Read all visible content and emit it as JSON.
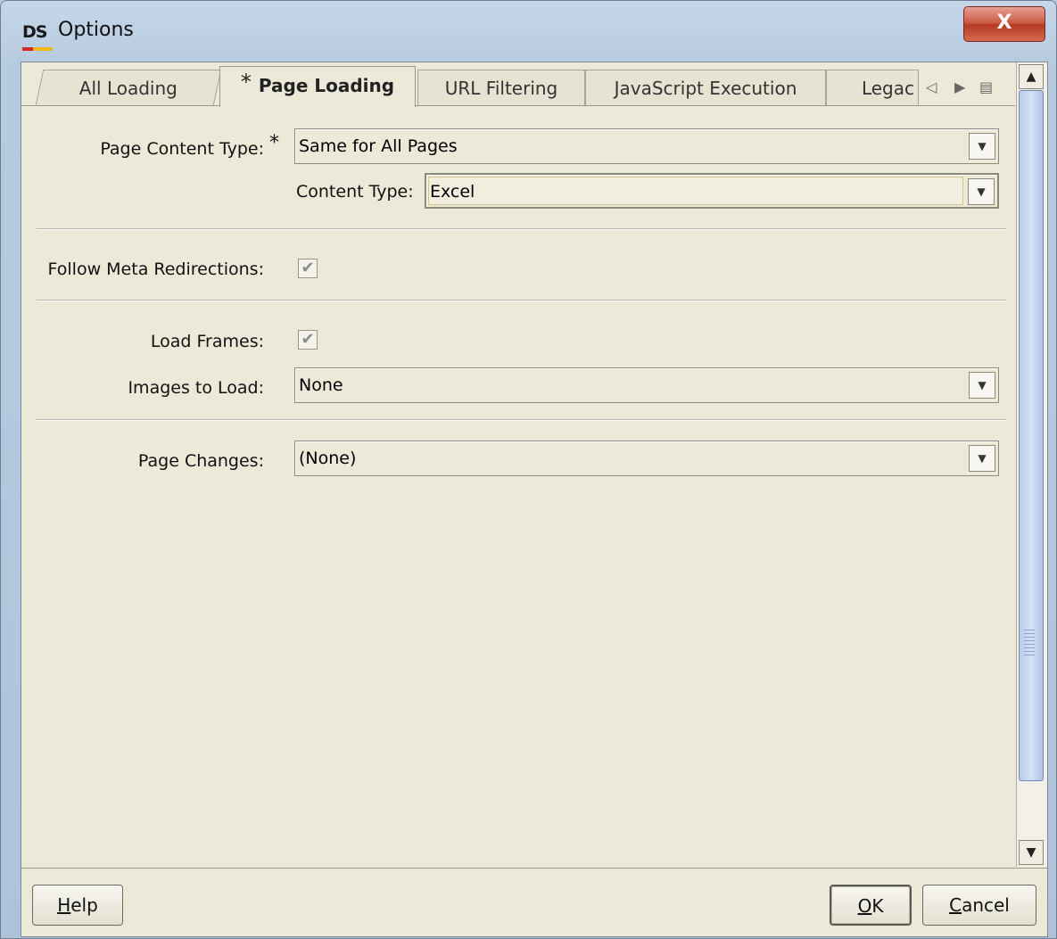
{
  "window": {
    "title": "Options",
    "logo_text": "DS",
    "close_glyph": "X"
  },
  "tabs": [
    {
      "label": "All Loading",
      "active": false
    },
    {
      "label": "Page Loading",
      "active": true,
      "modified_marker": "*"
    },
    {
      "label": "URL Filtering",
      "active": false
    },
    {
      "label": "JavaScript Execution",
      "active": false
    },
    {
      "label": "Legac",
      "active": false
    }
  ],
  "tab_nav": {
    "prev": "◁",
    "next": "▶",
    "menu": "▤"
  },
  "form": {
    "page_content_type": {
      "label": "Page Content Type:",
      "marker": "*",
      "value": "Same for All Pages"
    },
    "content_type": {
      "label": "Content Type:",
      "value": "Excel"
    },
    "follow_meta_redirections": {
      "label": "Follow Meta Redirections:",
      "checked": true
    },
    "load_frames": {
      "label": "Load Frames:",
      "checked": true
    },
    "images_to_load": {
      "label": "Images to Load:",
      "value": "None"
    },
    "page_changes": {
      "label": "Page Changes:",
      "value": "(None)"
    }
  },
  "buttons": {
    "help": {
      "mnemonic": "H",
      "rest": "elp"
    },
    "ok": {
      "mnemonic": "O",
      "rest": "K"
    },
    "cancel": {
      "mnemonic": "C",
      "rest": "ancel"
    }
  },
  "scroll": {
    "up": "▲",
    "down": "▼"
  },
  "check_glyph": "✔",
  "drop_glyph": "▼"
}
